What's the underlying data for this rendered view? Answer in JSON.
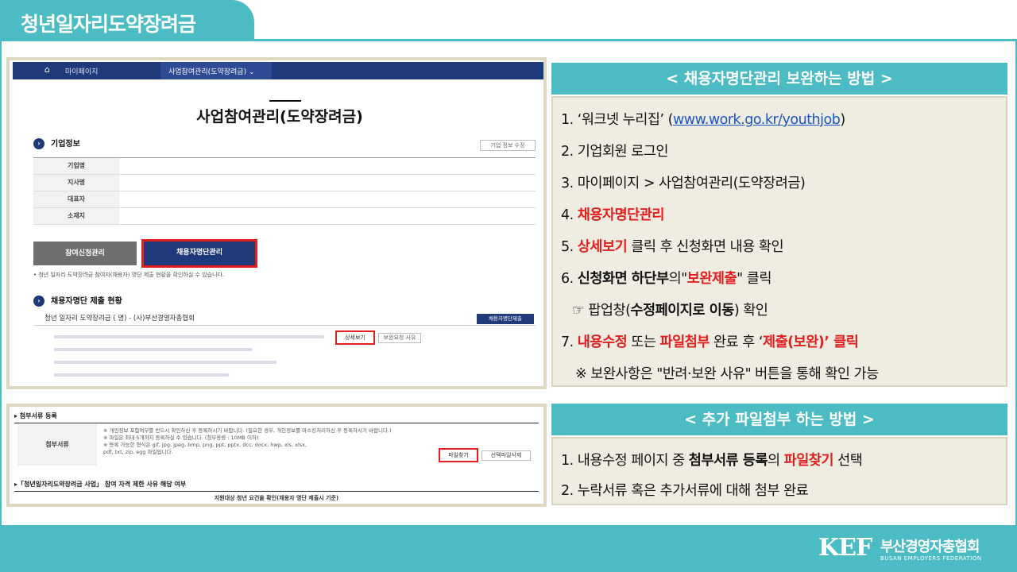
{
  "header": {
    "title": "청년일자리도약장려금"
  },
  "shot1": {
    "home_icon": "home-icon",
    "crumb_mypage": "마이페이지",
    "crumb_current": "사업참여관리(도약장려금) ⌄",
    "page_title": "사업참여관리(도약장려금)",
    "section_company": "기업정보",
    "edit_button": "기업 정보 수정",
    "info_labels": [
      "기업명",
      "지사명",
      "대표자",
      "소재지"
    ],
    "tab_apply": "참여신청관리",
    "tab_employee": "채용자명단관리",
    "note": "•  청년 일자리 도약장려금 참여자(채용자) 명단 제출 현황을 확인하실 수 있습니다.",
    "section_submit": "채용자명단 제출 현황",
    "submit_line": "청년 일자리 도약장려금 (      명) - (사)부산경영자총협회",
    "submit_button": "채용자명단제출",
    "detail_button": "상세보기",
    "reason_button": "보완요청 사유"
  },
  "shot2": {
    "head": "▸ 첨부서류 등록",
    "label": "첨부서류",
    "lines": [
      "※  개인정보 포함여부를 반드시 확인하신 후 등록하시기 바랍니다. (필요한 경우, 개인정보를 마스킹처리하신 후 등록하시기 바랍니다.)",
      "※  파일은 최대 5개까지 등록하실 수 있습니다. (첨부용량 : 10MB 이하)",
      "※  등록 가능한 형식은 gif, jpg, jpeg, bmp, png, ppt, pptx, dcc, docx, hwp, xls, xlsx,",
      "      pdf, txt, zip, egg 파일입니다."
    ],
    "find_button": "파일찾기",
    "delete_button": "선택파일삭제",
    "head2": "▸「청년일자리도약장려금 사업」 참여 자격 제한 사유 해당 여부",
    "sub": "지원대상 청년 요건을 확인(채용자 명단 제출시 기준)"
  },
  "panel1": {
    "title": "< 채용자명단관리 보완하는 방법 >",
    "s1_a": "1. ‘워크넷 누리집’  (",
    "s1_link": "www.work.go.kr/youthjob",
    "s1_b": ")",
    "s2": "2. 기업회원 로그인",
    "s3": "3. 마이페이지 > 사업참여관리(도약장려금)",
    "s4_num": "4. ",
    "s4_red": "채용자명단관리",
    "s5_num": "5. ",
    "s5_red": "상세보기",
    "s5_rest": " 클릭 후 신청화면 내용 확인",
    "s6_num": "6. ",
    "s6_bold": "신청화면 하단부",
    "s6_mid": "의\"",
    "s6_red": "보완제출",
    "s6_end": "\" 클릭",
    "s6b_icon": "☞",
    "s6b_a": " 팝업창(",
    "s6b_bold": "수정페이지로 이동",
    "s6b_end": ") 확인",
    "s7_num": "7. ",
    "s7_red1": "내용수정",
    "s7_mid1": " 또는 ",
    "s7_red2": "파일첨부",
    "s7_mid2": "  완료 후 ‘",
    "s7_red3": "제출(보완)’ 클릭",
    "s8": "※ 보완사항은 \"반려·보완 사유\" 버튼을 통해 확인 가능"
  },
  "panel2": {
    "title": "< 추가 파일첨부 하는 방법 >",
    "s1_a": "1. 내용수정 페이지 중  ",
    "s1_bold": "첨부서류 등록",
    "s1_mid": "의 ",
    "s1_red": "파일찾기",
    "s1_end": " 선택",
    "s2": "2. 누락서류 혹은 추가서류에 대해 첨부 완료"
  },
  "logo": {
    "kef": "KEF",
    "kor": "부산경영자총협회",
    "eng": "BUSAN EMPLOYERS FEDERATION"
  },
  "colors": {
    "teal": "#4bbcc4",
    "red": "#e21e1e",
    "navy": "#1e3a7a",
    "beige": "#efece1"
  }
}
